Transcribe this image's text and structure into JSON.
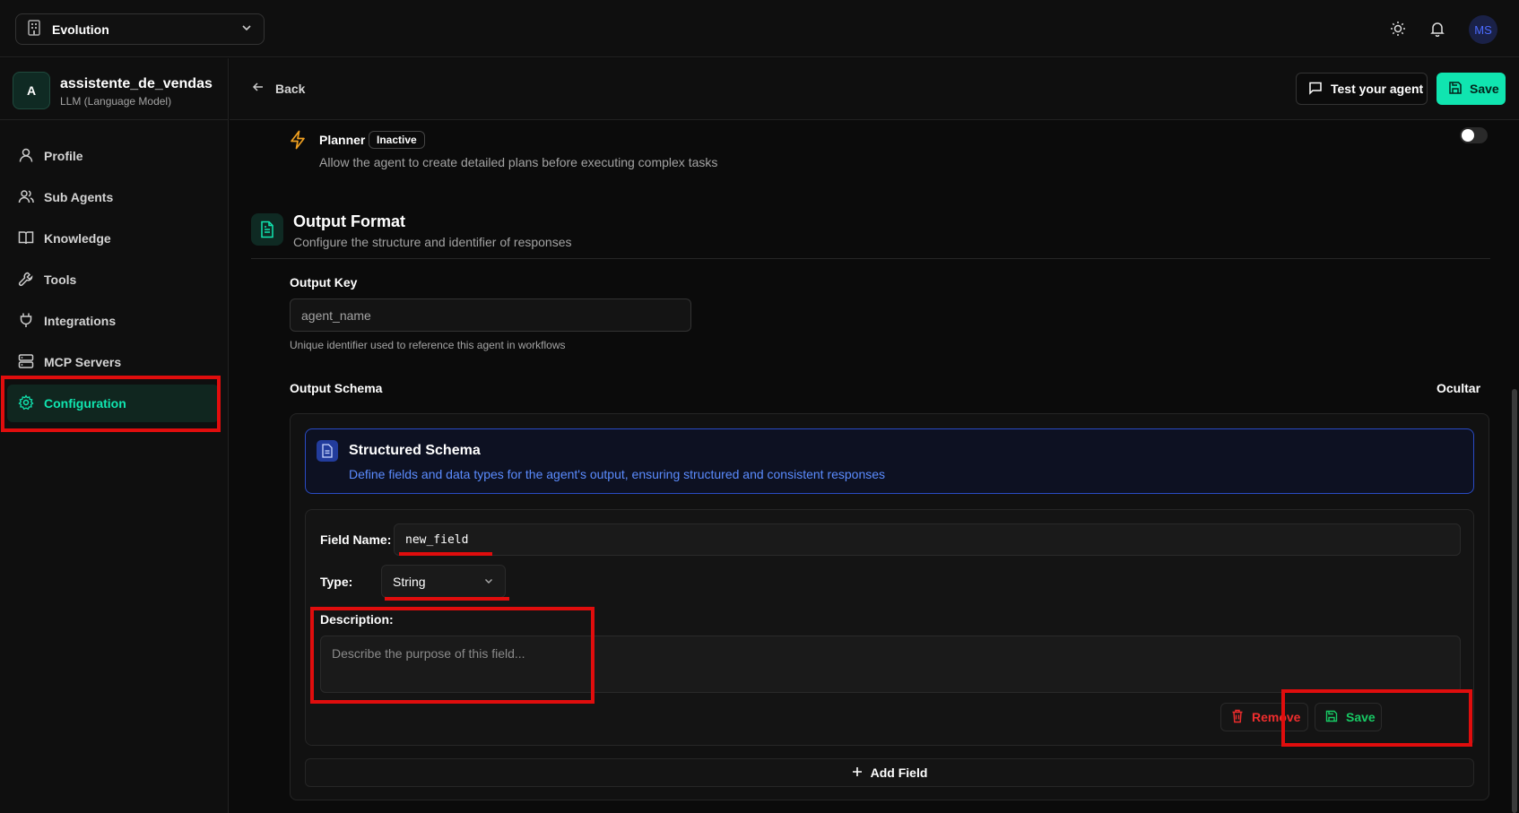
{
  "topbar": {
    "workspace": "Evolution",
    "avatar_initials": "MS",
    "icons": [
      "building-icon",
      "chevron-down-icon",
      "sun-icon",
      "bell-icon"
    ]
  },
  "agent": {
    "initial": "A",
    "name": "assistente_de_vendas",
    "type": "LLM (Language Model)"
  },
  "sidebar": {
    "items": [
      {
        "label": "Profile",
        "icon": "user-icon"
      },
      {
        "label": "Sub Agents",
        "icon": "users-icon"
      },
      {
        "label": "Knowledge",
        "icon": "book-icon"
      },
      {
        "label": "Tools",
        "icon": "wrench-icon"
      },
      {
        "label": "Integrations",
        "icon": "plug-icon"
      },
      {
        "label": "MCP Servers",
        "icon": "server-icon"
      },
      {
        "label": "Configuration",
        "icon": "gear-icon",
        "active": true
      }
    ]
  },
  "header": {
    "back_label": "Back",
    "test_label": "Test your agent",
    "save_label": "Save"
  },
  "planner": {
    "title": "Planner",
    "badge": "Inactive",
    "description": "Allow the agent to create detailed plans before executing complex tasks",
    "enabled": false
  },
  "output_format": {
    "title": "Output Format",
    "subtitle": "Configure the structure and identifier of responses",
    "output_key_label": "Output Key",
    "output_key_placeholder": "agent_name",
    "output_key_hint": "Unique identifier used to reference this agent in workflows",
    "schema_label": "Output Schema",
    "toggle_label": "Ocultar"
  },
  "schema": {
    "info_title": "Structured Schema",
    "info_desc": "Define fields and data types for the agent's output, ensuring structured and consistent responses",
    "field": {
      "name_label": "Field Name:",
      "name_value": "new_field",
      "type_label": "Type:",
      "type_value": "String",
      "description_label": "Description:",
      "description_placeholder": "Describe the purpose of this field...",
      "remove_label": "Remove",
      "save_label": "Save"
    },
    "add_field_label": "Add Field"
  },
  "colors": {
    "accent": "#10e5b0",
    "danger": "#ef2d2d",
    "success": "#17c964",
    "highlight": "#e00d0d",
    "info": "#5b8cff"
  }
}
